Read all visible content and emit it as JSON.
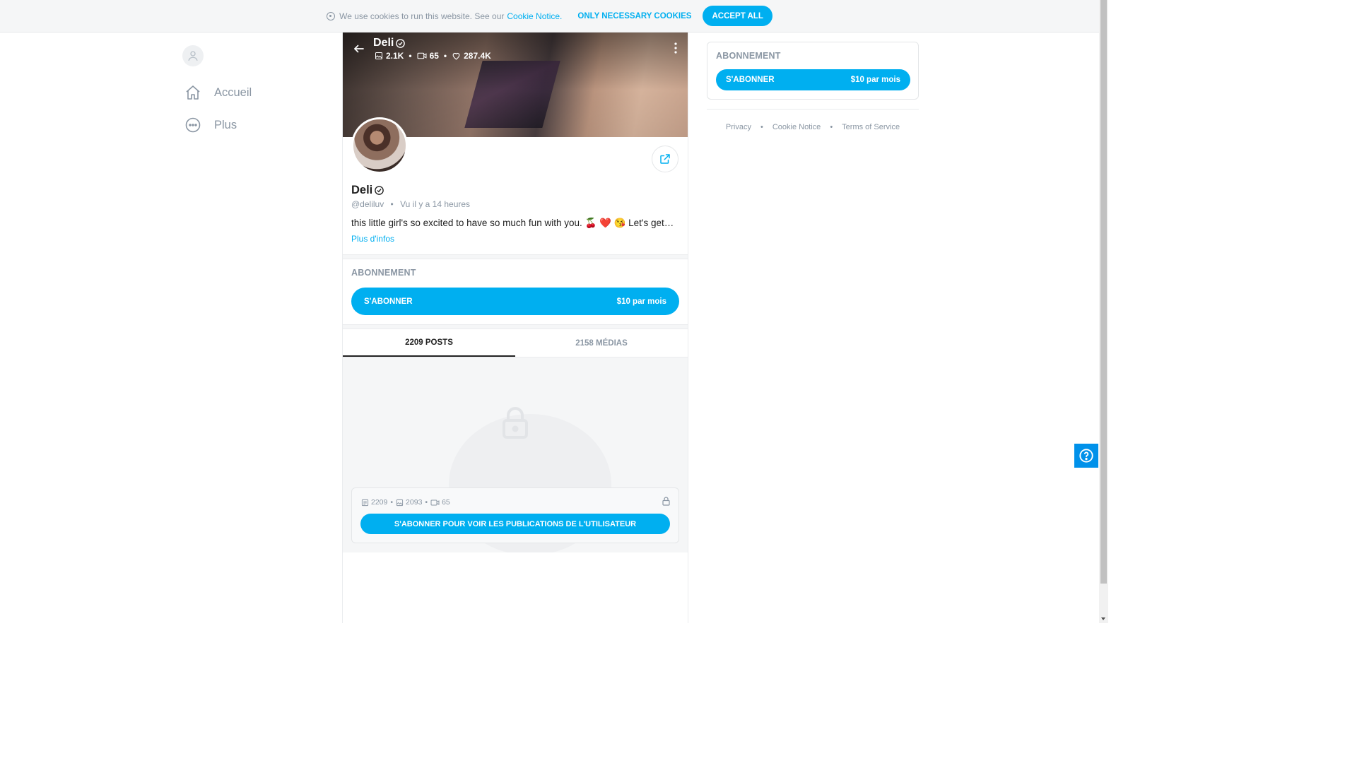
{
  "cookie": {
    "text": "We use cookies to run this website. See our",
    "link": "Cookie Notice.",
    "only_necessary": "ONLY NECESSARY COOKIES",
    "accept_all": "ACCEPT ALL"
  },
  "nav": {
    "items": [
      {
        "label": "Accueil",
        "icon": "home-icon"
      },
      {
        "label": "Plus",
        "icon": "more-circle-icon"
      }
    ]
  },
  "profile": {
    "name": "Deli",
    "stats": {
      "photos": "2.1K",
      "videos": "65",
      "likes": "287.4K"
    },
    "handle": "@deliluv",
    "seen": "Vu  il y a 14 heures",
    "bio": "this little girl's so excited to have so much fun with you. 🍒 ❤️ 😘  Let's get…",
    "more_info": "Plus d'infos"
  },
  "subscription": {
    "label": "ABONNEMENT",
    "button": "S'ABONNER",
    "price": "$10 par mois"
  },
  "tabs": [
    {
      "label": "2209 POSTS",
      "active": true
    },
    {
      "label": "2158 MÉDIAS",
      "active": false
    }
  ],
  "locked": {
    "posts": "2209",
    "photos": "2093",
    "videos": "65",
    "cta": "S'ABONNER POUR VOIR LES PUBLICATIONS DE L'UTILISATEUR"
  },
  "footer": {
    "links": [
      "Privacy",
      "Cookie Notice",
      "Terms of Service"
    ]
  },
  "colors": {
    "accent": "#00aff0",
    "muted": "#8a96a3",
    "help": "#0091ea"
  }
}
